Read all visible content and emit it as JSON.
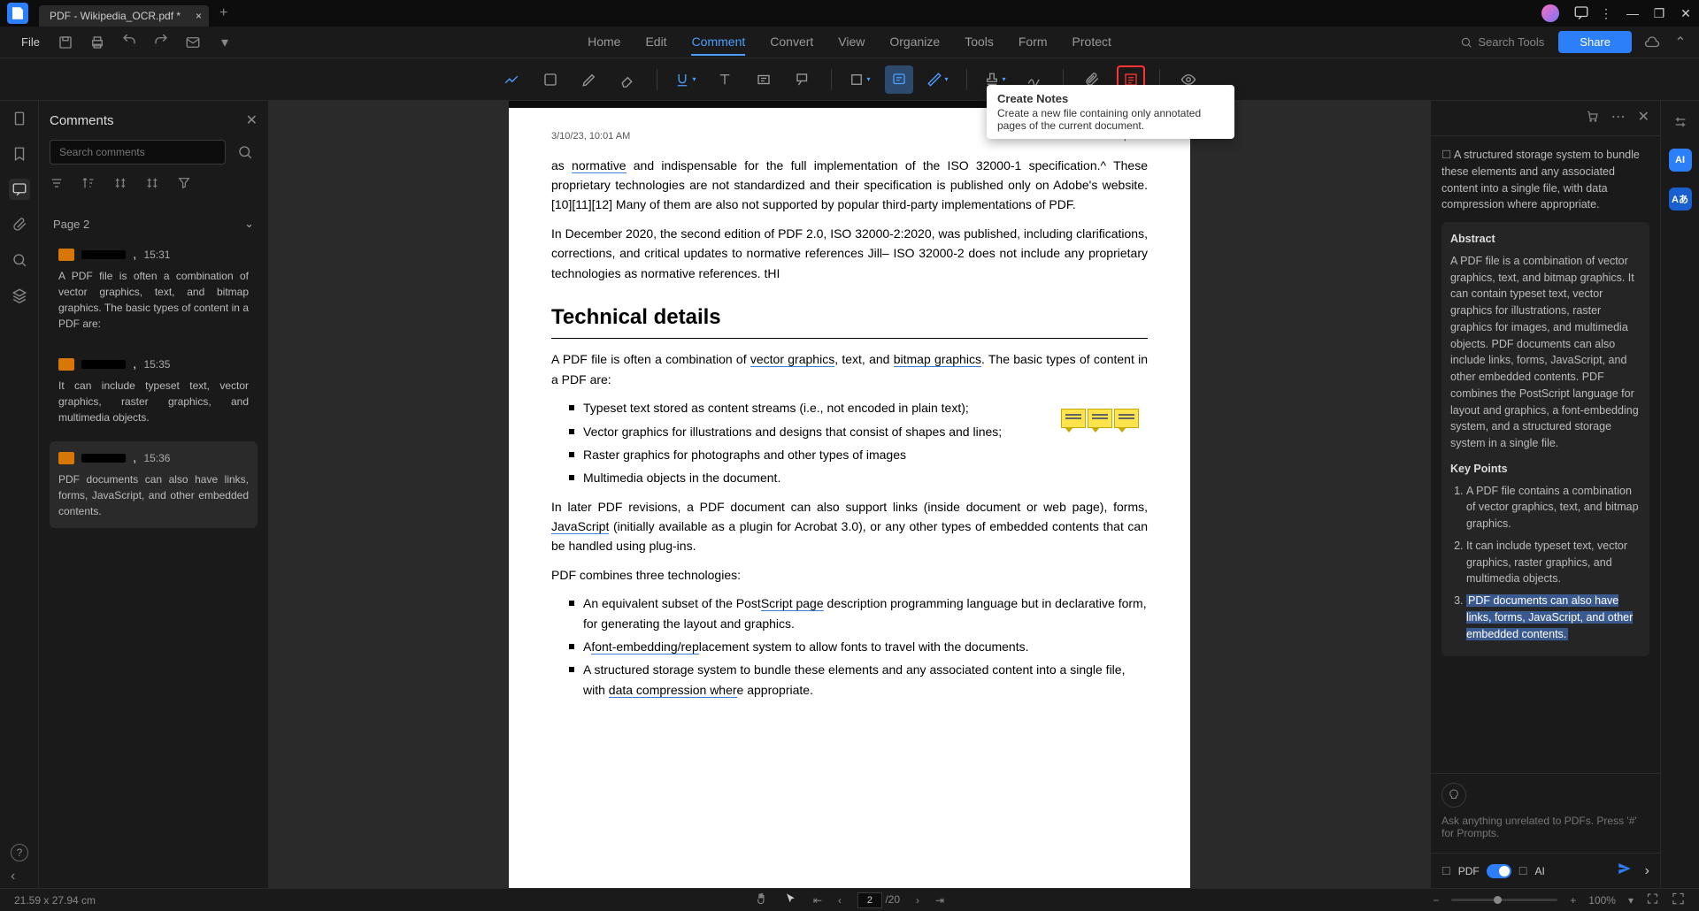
{
  "title_bar": {
    "tab_title": "PDF - Wikipedia_OCR.pdf *"
  },
  "menu": {
    "file": "File"
  },
  "main_tabs": [
    "Home",
    "Edit",
    "Comment",
    "Convert",
    "View",
    "Organize",
    "Tools",
    "Form",
    "Protect"
  ],
  "active_tab": "Comment",
  "search_tools": "Search Tools",
  "share": "Share",
  "tooltip": {
    "title": "Create Notes",
    "desc": "Create a new file containing only annotated pages of the current document."
  },
  "comments_panel": {
    "title": "Comments",
    "search_placeholder": "Search comments",
    "page_label": "Page 2",
    "items": [
      {
        "time": "15:31",
        "text": "A PDF file is often a combination of vector graphics, text, and bitmap graphics. The basic types of content in a PDF are:"
      },
      {
        "time": "15:35",
        "text": "It can include typeset text, vector graphics, raster graphics, and multimedia objects."
      },
      {
        "time": "15:36",
        "text": "PDF documents can also have links, forms, JavaScript, and other embedded contents."
      }
    ]
  },
  "document": {
    "timestamp": "3/10/23, 10:01 AM",
    "header_title": "PDF - Wikipedia",
    "para1_a": "as ",
    "para1_link1": "normative",
    "para1_b": " and indispensable for the full implementation of the ISO 32000-1 specification.^ These proprietary technologies are not standardized and their specification is published only on Adobe's website.[10][11][12] Many of them are also not supported by popular third-party implementations of PDF.",
    "para2": "In December 2020, the second edition of PDF 2.0, ISO 32000-2:2020, was published, including clarifications, corrections, and critical updates to normative references Jill– ISO 32000-2 does not include any proprietary technologies as normative references. tHI",
    "heading": "Technical details",
    "para3_a": "A PDF file is often a combination of ",
    "para3_link1": "vector graphics",
    "para3_b": ", text, and ",
    "para3_link2": "bitmap graphics",
    "para3_c": ". The basic types of content in a PDF are:",
    "bullets1": [
      "Typeset text stored as content streams (i.e., not encoded in plain text);",
      "Vector graphics for illustrations and designs that consist of shapes and lines;",
      "Raster graphics for photographs and other types of images",
      "Multimedia objects in the document."
    ],
    "para4_a": "In later PDF revisions, a PDF document can also support links (inside document or web page), forms, ",
    "para4_link": "JavaScript",
    "para4_b": " (initially available as a plugin for Acrobat 3.0), or any other types of embedded contents that can be handled using plug-ins.",
    "para5": "PDF combines three technologies:",
    "bullets2_1_a": "An equivalent subset of the Post",
    "bullets2_1_link": "Script page",
    "bullets2_1_b": " description programming language but in declarative form, for generating the layout and graphics.",
    "bullets2_2_a": "A",
    "bullets2_2_link": "font-embedding/rep",
    "bullets2_2_b": "lacement system to allow fonts to travel with the documents.",
    "bullets2_3_a": "A structured storage system to bundle these elements and any associated content into a single file, with ",
    "bullets2_3_link": "data compression wher",
    "bullets2_3_b": "e appropriate."
  },
  "ai_panel": {
    "intro": "A structured storage system to bundle these elements and any associated content into a single file, with data compression where appropriate.",
    "abstract_title": "Abstract",
    "abstract": "A PDF file is a combination of vector graphics, text, and bitmap graphics. It can contain typeset text, vector graphics for illustrations, raster graphics for images, and multimedia objects. PDF documents can also include links, forms, JavaScript, and other embedded contents. PDF combines the PostScript language for layout and graphics, a font-embedding system, and a structured storage system in a single file.",
    "keypoints_title": "Key Points",
    "points": [
      "A PDF file contains a combination of vector graphics, text, and bitmap graphics.",
      "It can include typeset text, vector graphics, raster graphics, and multimedia objects.",
      "PDF documents can also have links, forms, JavaScript, and other embedded contents."
    ],
    "chat_placeholder": "Ask anything unrelated to PDFs. Press '#' for Prompts.",
    "pdf_label": "PDF",
    "ai_label": "AI"
  },
  "status": {
    "dimensions": "21.59 x 27.94 cm",
    "page_current": "2",
    "page_total": "/20",
    "zoom": "100%"
  }
}
